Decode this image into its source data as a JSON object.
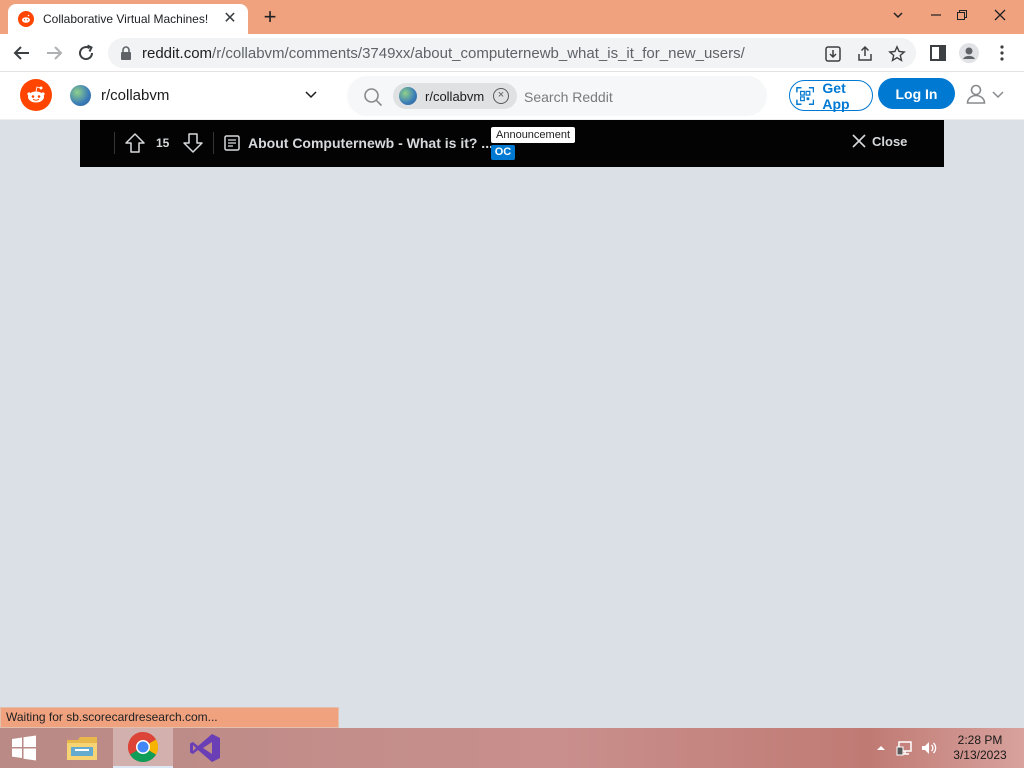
{
  "browser": {
    "tab_title": "Collaborative Virtual Machines!",
    "url_domain": "reddit.com",
    "url_path": "/r/collabvm/comments/3749xx/about_computernewb_what_is_it_for_new_users/",
    "status_text": "Waiting for sb.scorecardresearch.com..."
  },
  "reddit_header": {
    "community_name": "r/collabvm",
    "search_chip": "r/collabvm",
    "search_placeholder": "Search Reddit",
    "get_app_label": "Get App",
    "login_label": "Log In"
  },
  "post_bar": {
    "vote_count": "15",
    "title": "About Computernewb - What is it? ...",
    "flair_announcement": "Announcement",
    "flair_oc": "OC",
    "close_label": "Close"
  },
  "taskbar": {
    "time": "2:28 PM",
    "date": "3/13/2023",
    "apps": [
      "file-explorer",
      "google-chrome",
      "visual-studio"
    ]
  },
  "colors": {
    "tabstrip": "#f0a27e",
    "reddit_orange": "#ff4500",
    "reddit_blue": "#0079d3",
    "page_background": "#dae0e6",
    "post_bar": "#030303"
  }
}
